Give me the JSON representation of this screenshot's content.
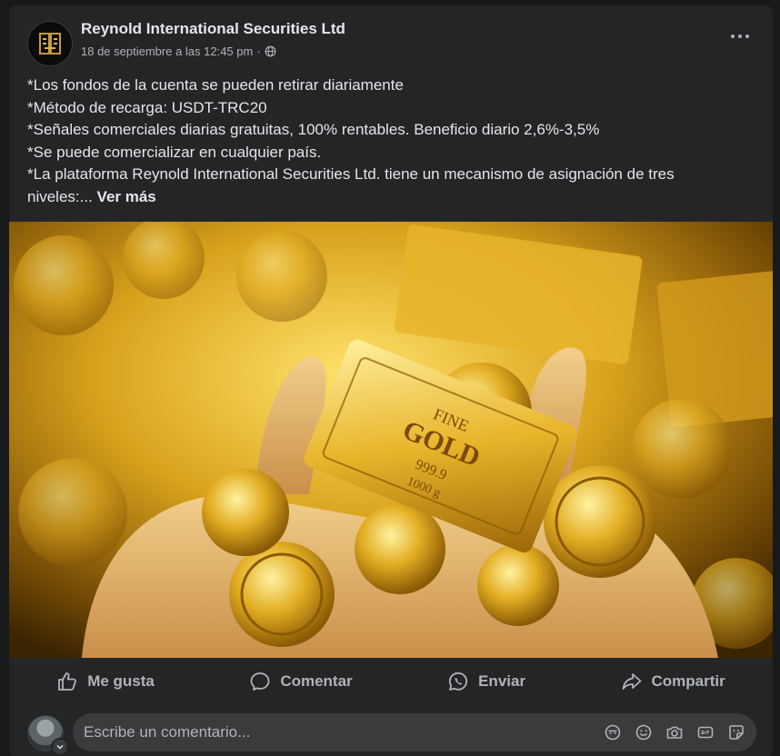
{
  "post": {
    "author": "Reynold International Securities Ltd",
    "timestamp": "18 de septiembre a las 12:45 pm",
    "separator": "·",
    "audience_icon": "globe-icon",
    "lines": [
      "*Los fondos de la cuenta se pueden retirar diariamente",
      "*Método de recarga: USDT-TRC20",
      "*Señales comerciales diarias gratuitas, 100% rentables. Beneficio diario 2,6%-3,5%",
      "*Se puede comercializar en cualquier país.",
      "*La plataforma Reynold International Securities Ltd. tiene un mecanismo de asignación de tres",
      "niveles:..."
    ],
    "see_more": "Ver más",
    "image_text": {
      "bar_line1": "FINE",
      "bar_line2": "GOLD",
      "bar_line3": "999.9",
      "bar_line4": "1000 g"
    }
  },
  "actions": {
    "like": "Me gusta",
    "comment": "Comentar",
    "send": "Enviar",
    "share": "Compartir"
  },
  "composer": {
    "placeholder": "Escribe un comentario..."
  },
  "colors": {
    "background": "#18191a",
    "card": "#242526",
    "text_primary": "#e4e6eb",
    "text_secondary": "#b0b3b8",
    "input_bg": "#3a3b3c",
    "gold": "#d4a017"
  }
}
